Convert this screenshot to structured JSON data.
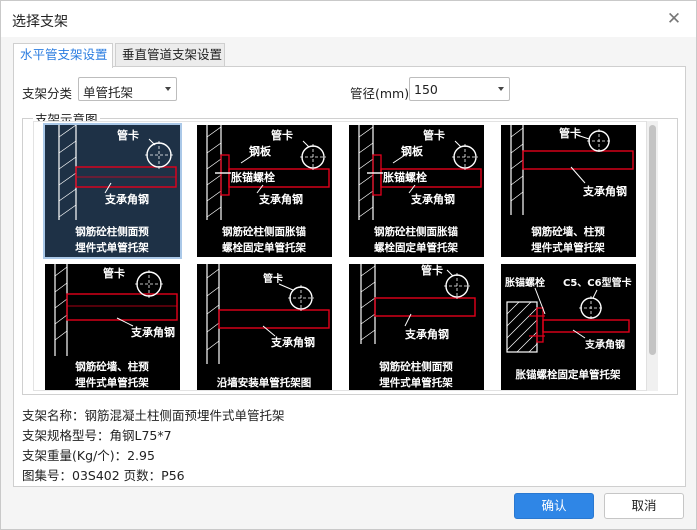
{
  "window": {
    "title": "选择支架",
    "close_glyph": "✕"
  },
  "tabs": [
    {
      "label": "水平管支架设置",
      "active": true
    },
    {
      "label": "垂直管道支架设置",
      "active": false
    }
  ],
  "form": {
    "category_label": "支架分类",
    "category_value": "单管托架",
    "diameter_label": "管径(mm)",
    "diameter_value": "150"
  },
  "diagram_group": {
    "legend": "支架示意图",
    "thumbnails": [
      {
        "labels": [
          "管卡",
          "支承角钢"
        ],
        "caption": [
          "钢筋砼柱侧面预",
          "埋件式单管托架"
        ],
        "selected": true
      },
      {
        "labels": [
          "管卡",
          "钢板",
          "胀锚螺栓",
          "支承角钢"
        ],
        "caption": [
          "钢筋砼柱侧面胀锚",
          "螺栓固定单管托架"
        ],
        "selected": false
      },
      {
        "labels": [
          "管卡",
          "钢板",
          "胀锚螺栓",
          "支承角钢"
        ],
        "caption": [
          "钢筋砼柱侧面胀锚",
          "螺栓固定单管托架"
        ],
        "selected": false
      },
      {
        "labels": [
          "管卡",
          "支承角钢"
        ],
        "caption": [
          "钢筋砼墙、柱预",
          "埋件式单管托架"
        ],
        "selected": false
      },
      {
        "labels": [
          "管卡",
          "支承角钢"
        ],
        "caption": [
          "钢筋砼墙、柱预",
          "埋件式单管托架"
        ],
        "selected": false
      },
      {
        "labels": [
          "管卡",
          "支承角钢"
        ],
        "caption": [
          "沿墙安装单管托架图"
        ],
        "selected": false
      },
      {
        "labels": [
          "管卡",
          "支承角钢"
        ],
        "caption": [
          "钢筋砼柱侧面预",
          "埋件式单管托架"
        ],
        "selected": false
      },
      {
        "labels": [
          "胀锚螺栓",
          "C5、C6型管卡",
          "支承角钢"
        ],
        "caption": [
          "胀锚螺栓固定单管托架"
        ],
        "selected": false
      }
    ]
  },
  "info": {
    "name": "支架名称：钢筋混凝土柱侧面预埋件式单管托架",
    "spec": "支架规格型号：角钢L75*7",
    "weight": "支架重量(Kg/个)：2.95",
    "atlas": "图集号：03S402  页数：P56"
  },
  "buttons": {
    "ok": "确认",
    "cancel": "取消"
  },
  "colors": {
    "accent": "#2f86e6",
    "diagram_red": "#e3001b",
    "diagram_bg": "#000000",
    "selected_bg": "#1e3146"
  }
}
